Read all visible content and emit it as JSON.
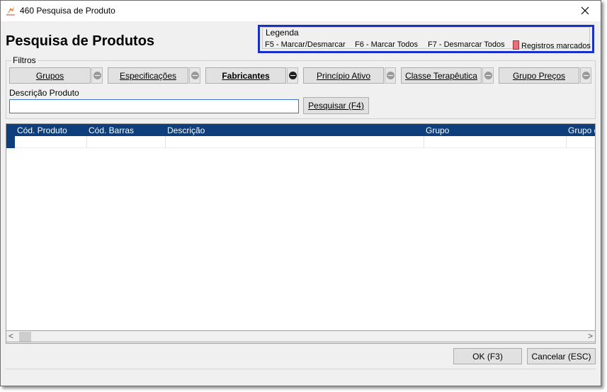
{
  "window": {
    "title": "460 Pesquisa de Produto",
    "close_glyph": "✕"
  },
  "page": {
    "title": "Pesquisa de Produtos"
  },
  "legend": {
    "title": "Legenda",
    "items": [
      "F5 - Marcar/Desmarcar",
      "F6 - Marcar Todos",
      "F7 - Desmarcar Todos"
    ],
    "marked_label": "Registros marcados",
    "marked_color": "#e8707a"
  },
  "filters": {
    "label": "Filtros",
    "buttons": [
      {
        "label": "Grupos",
        "active": false
      },
      {
        "label": "Especificações",
        "active": false
      },
      {
        "label": "Fabricantes",
        "active": true
      },
      {
        "label": "Princípio Ativo",
        "active": false
      },
      {
        "label": "Classe Terapêutica",
        "active": false
      },
      {
        "label": "Grupo Preços",
        "active": false
      }
    ],
    "description_label": "Descrição Produto",
    "description_value": "",
    "search_button": "Pesquisar (F4)"
  },
  "grid": {
    "columns": [
      "Cód. Produto",
      "Cód. Barras",
      "Descrição",
      "Grupo",
      "Grupo d"
    ],
    "header_color": "#0e3e7c"
  },
  "scrollbar": {
    "left_arrow": "<",
    "right_arrow": ">"
  },
  "actions": {
    "ok": "OK (F3)",
    "cancel": "Cancelar (ESC)"
  }
}
